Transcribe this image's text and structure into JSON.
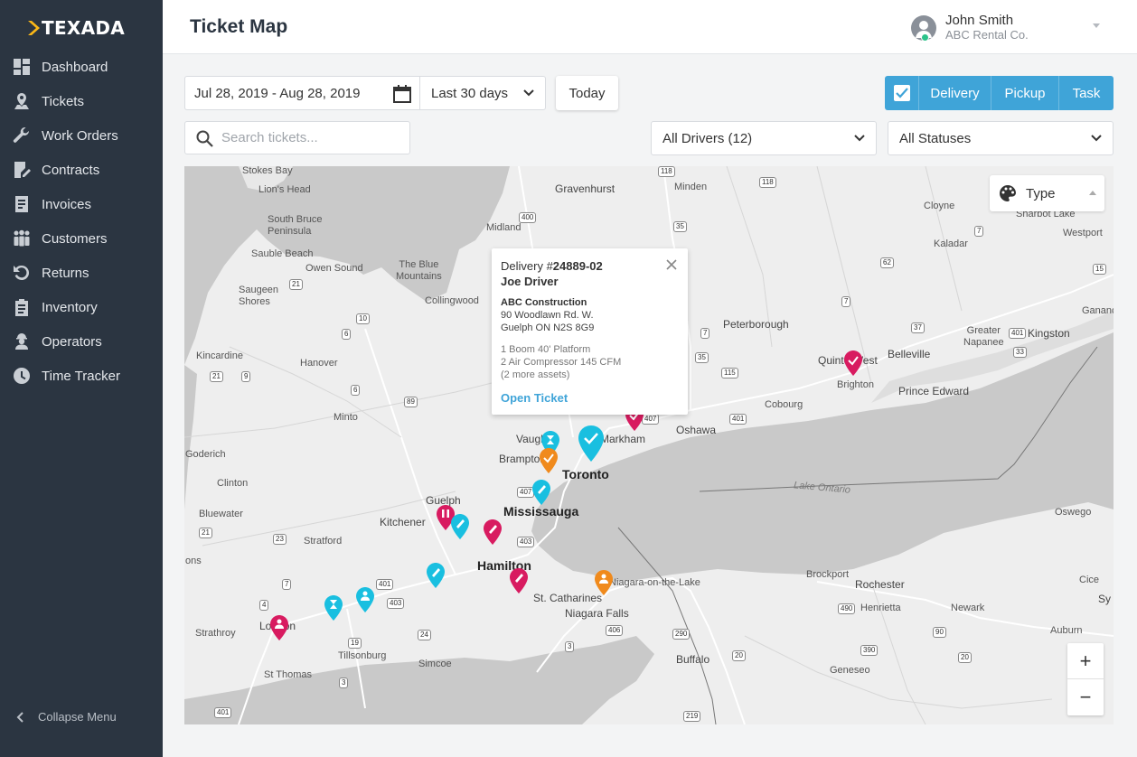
{
  "brand": {
    "name": "TEXADA"
  },
  "sidebar": {
    "items": [
      {
        "label": "Dashboard",
        "icon": "dashboard-icon"
      },
      {
        "label": "Tickets",
        "icon": "map-pin-icon"
      },
      {
        "label": "Work Orders",
        "icon": "wrench-icon"
      },
      {
        "label": "Contracts",
        "icon": "contract-icon"
      },
      {
        "label": "Invoices",
        "icon": "invoice-icon"
      },
      {
        "label": "Customers",
        "icon": "customers-icon"
      },
      {
        "label": "Returns",
        "icon": "returns-icon"
      },
      {
        "label": "Inventory",
        "icon": "clipboard-icon"
      },
      {
        "label": "Operators",
        "icon": "operator-icon"
      },
      {
        "label": "Time Tracker",
        "icon": "clock-icon"
      }
    ],
    "collapse_label": "Collapse Menu"
  },
  "header": {
    "title": "Ticket Map",
    "user_name": "John Smith",
    "user_company": "ABC Rental Co."
  },
  "filters": {
    "date_range": "Jul 28, 2019 - Aug 28, 2019",
    "period": "Last 30 days",
    "today_label": "Today",
    "type_toggle": [
      "Delivery",
      "Pickup",
      "Task"
    ],
    "search_placeholder": "Search tickets...",
    "drivers": "All Drivers (12)",
    "statuses": "All Statuses"
  },
  "map": {
    "type_control": "Type",
    "zoom_in": "+",
    "zoom_out": "−",
    "places": {
      "toronto": "Toronto",
      "mississauga": "Mississauga",
      "hamilton": "Hamilton",
      "markham": "Markham",
      "vaughan": "Vaughan",
      "brampton": "Brampton",
      "oshawa": "Oshawa",
      "guelph": "Guelph",
      "kitchener": "Kitchener",
      "london": "London",
      "st_catharines": "St. Catharines",
      "niagara_falls": "Niagara Falls",
      "niagara_otl": "Niagara-on-the-Lake",
      "buffalo": "Buffalo",
      "rochester": "Rochester",
      "kingston": "Kingston",
      "belleville": "Belleville",
      "peterborough": "Peterborough",
      "cobourg": "Cobourg",
      "brighton": "Brighton",
      "quinte_west": "Quinte West",
      "prince_edward": "Prince Edward",
      "lake_ontario": "Lake Ontario",
      "oswego": "Oswego",
      "stokes_bay": "Stokes Bay",
      "lions_head": "Lion's Head",
      "south_bruce": "South Bruce\nPeninsula",
      "sauble": "Sauble Beach",
      "owen_sound": "Owen Sound",
      "blue_mtn": "The Blue\nMountains",
      "collingwood": "Collingwood",
      "saugeen": "Saugeen\nShores",
      "kincardine": "Kincardine",
      "hanover": "Hanover",
      "minto": "Minto",
      "goderich": "Goderich",
      "clinton": "Clinton",
      "bluewater": "Bluewater",
      "stratford": "Stratford",
      "strathroy": "Strathroy",
      "tillsonburg": "Tillsonburg",
      "simcoe": "Simcoe",
      "st_thomas": "St Thomas",
      "gravenhurst": "Gravenhurst",
      "midland": "Midland",
      "minden": "Minden",
      "clayne": "Cloyne",
      "kaladar": "Kaladar",
      "sharbot": "Sharbot Lake",
      "westport": "Westport",
      "greater_napanee": "Greater\nNapanee",
      "brockport": "Brockport",
      "henrietta": "Henrietta",
      "newark": "Newark",
      "auburn": "Auburn",
      "geneseo": "Geneseo",
      "ganano": "Ganano",
      "cice": "Cice",
      "sy": "Sy",
      "ons": "ons"
    }
  },
  "popup": {
    "type": "Delivery #",
    "number": "24889-02",
    "driver": "Joe Driver",
    "company": "ABC Construction",
    "address1": "90 Woodlawn Rd. W.",
    "address2": "Guelph ON N2S 8G9",
    "asset1": "1 Boom 40' Platform",
    "asset2": "2 Air Compressor 145 CFM",
    "asset3": "(2 more assets)",
    "open_label": "Open Ticket"
  },
  "colors": {
    "delivery": "#19bfe0",
    "pickup": "#d81b60",
    "task": "#f08a1c",
    "accent": "#3fa4d8"
  }
}
